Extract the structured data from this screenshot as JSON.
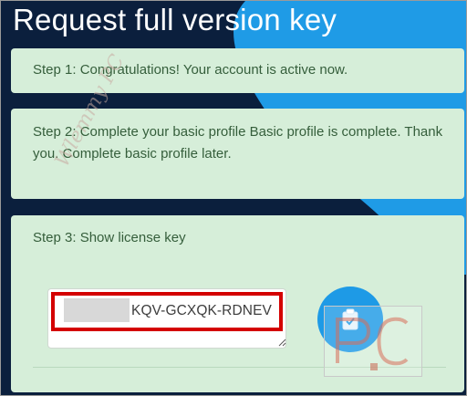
{
  "page": {
    "title": "Request full version key"
  },
  "steps": [
    {
      "text": "Step 1: Congratulations! Your account is active now."
    },
    {
      "text": "Step 2: Complete your basic profile Basic profile is complete. Thank you. Complete basic profile later."
    },
    {
      "text": "Step 3: Show license key"
    }
  ],
  "license": {
    "visible_part": "KQV-GCXQK-RDNEV"
  },
  "icons": {
    "copy": "clipboard-icon",
    "watermark": "pc-logo"
  },
  "colors": {
    "accent": "#1e9ae6",
    "background": "#0b1f3d",
    "card": "#d6eed9",
    "highlight": "#d40000"
  },
  "watermark": {
    "text": "Wlemmy PC"
  }
}
